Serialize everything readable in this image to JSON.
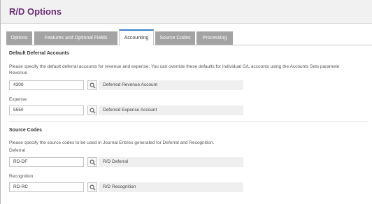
{
  "window": {
    "title": "R/D Options"
  },
  "tabs": [
    {
      "label": "Options"
    },
    {
      "label": "Features and Optional Fields"
    },
    {
      "label": "Accounting"
    },
    {
      "label": "Source Codes"
    },
    {
      "label": "Processing"
    }
  ],
  "active_tab": "Accounting",
  "deferral_accounts": {
    "title": "Default Deferral Accounts",
    "description": "Please specify the default deferral accounts for revenue and expense. You can override these defaults for individual G/L accounts using the Accounts Sets paramete",
    "revenue": {
      "label": "Revenue",
      "value": "4300",
      "description": "Deferred Revenue Account"
    },
    "expense": {
      "label": "Expense",
      "value": "5550",
      "description": "Deferred Expense Account"
    }
  },
  "source_codes": {
    "title": "Source Codes",
    "description": "Please specify the source codes to be used in Journal Entries generated for Deferral and Recognition.",
    "deferral": {
      "label": "Deferral",
      "value": "RD-DF",
      "description": "R/D Deferral"
    },
    "recognition": {
      "label": "Recognition",
      "value": "RD-RC",
      "description": "R/D Recognition"
    }
  },
  "icons": {
    "lookup": "search-icon"
  },
  "colors": {
    "title": "#6b2d78",
    "tab_inactive": "#a3a3a3",
    "tab_active_border": "#3b7fc4"
  }
}
